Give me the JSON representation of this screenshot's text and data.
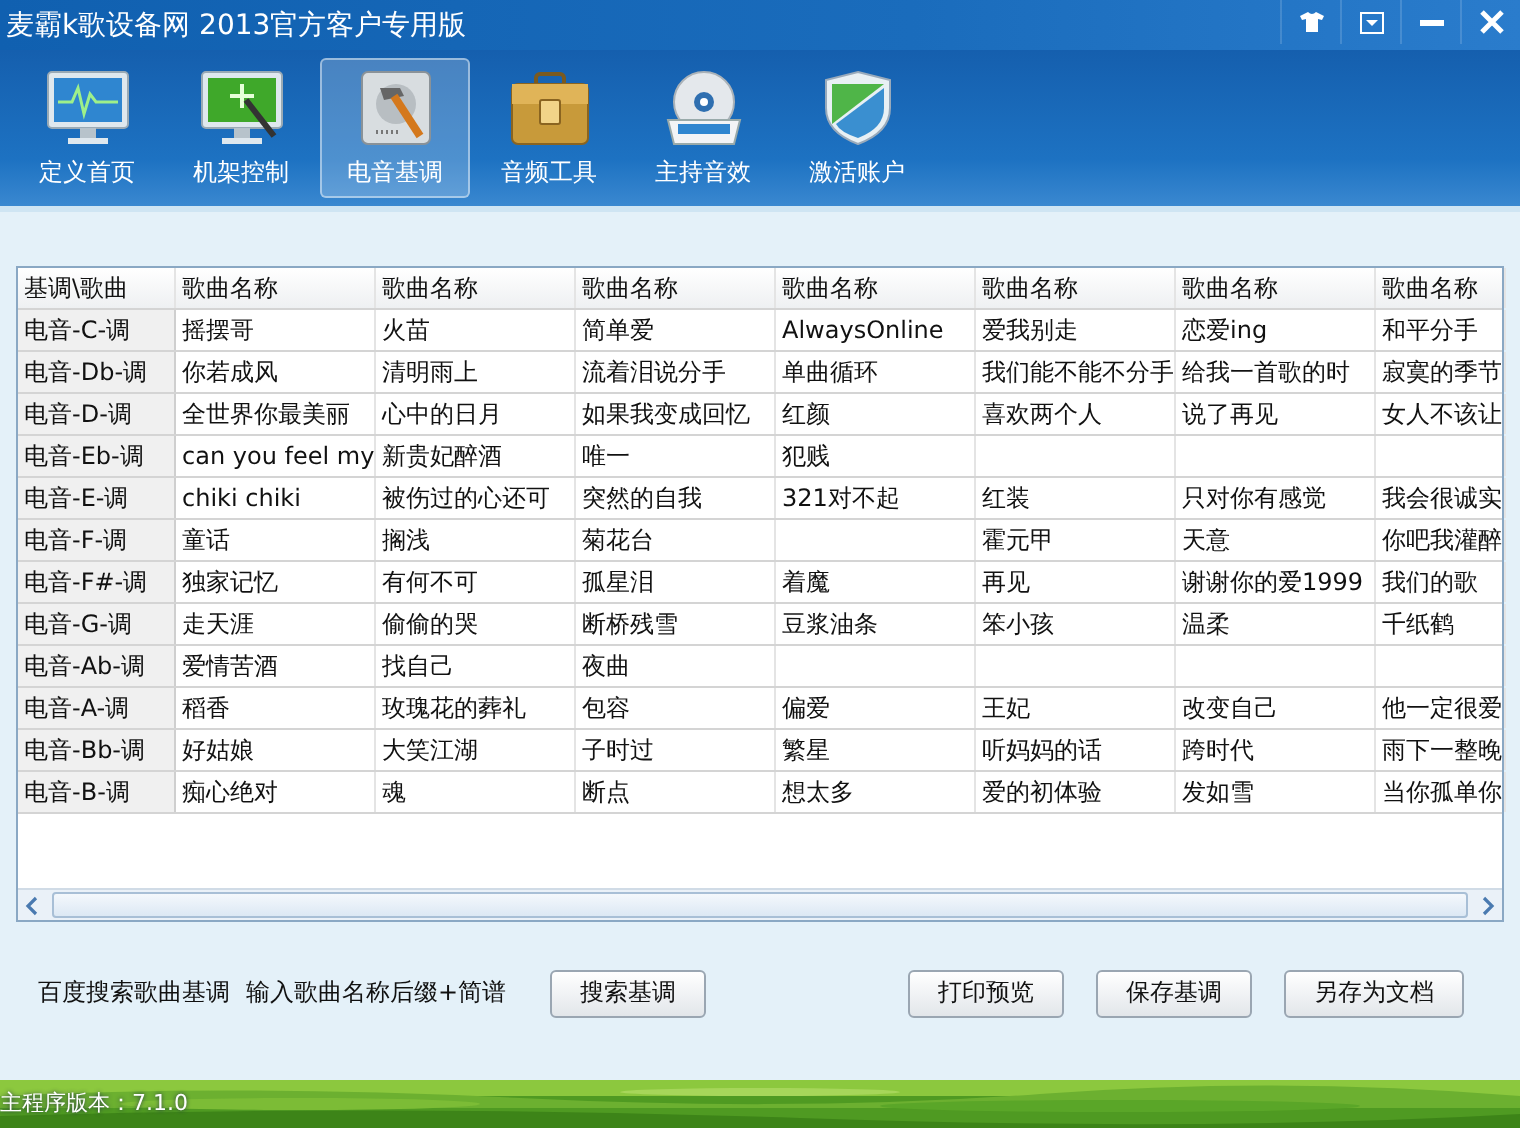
{
  "window": {
    "title": "麦霸k歌设备网 2013官方客户专用版"
  },
  "toolbar": [
    {
      "label": "定义首页",
      "selected": false
    },
    {
      "label": "机架控制",
      "selected": false
    },
    {
      "label": "电音基调",
      "selected": true
    },
    {
      "label": "音频工具",
      "selected": false
    },
    {
      "label": "主持音效",
      "selected": false
    },
    {
      "label": "激活账户",
      "selected": false
    }
  ],
  "table": {
    "columns": [
      "基调\\歌曲",
      "歌曲名称",
      "歌曲名称",
      "歌曲名称",
      "歌曲名称",
      "歌曲名称",
      "歌曲名称",
      "歌曲名称"
    ],
    "rows": [
      [
        "电音-C-调",
        "摇摆哥",
        "火苗",
        "简单爱",
        "AlwaysOnline",
        "爱我别走",
        "恋爱ing",
        "和平分手"
      ],
      [
        "电音-Db-调",
        "你若成风",
        "清明雨上",
        "流着泪说分手",
        "单曲循环",
        "我们能不能不分手",
        "给我一首歌的时",
        "寂寞的季节"
      ],
      [
        "电音-D-调",
        "全世界你最美丽",
        "心中的日月",
        "如果我变成回忆",
        "红颜",
        "喜欢两个人",
        "说了再见",
        "女人不该让"
      ],
      [
        "电音-Eb-调",
        "can you feel my",
        "新贵妃醉酒",
        "唯一",
        "犯贱",
        null,
        null,
        null
      ],
      [
        "电音-E-调",
        "chiki chiki",
        "被伤过的心还可",
        "突然的自我",
        "321对不起",
        "红装",
        "只对你有感觉",
        "我会很诚实"
      ],
      [
        "电音-F-调",
        "童话",
        "搁浅",
        "菊花台",
        null,
        "霍元甲",
        "天意",
        "你吧我灌醉"
      ],
      [
        "电音-F#-调",
        "独家记忆",
        "有何不可",
        "孤星泪",
        "着魔",
        "再见",
        "谢谢你的爱1999",
        "我们的歌"
      ],
      [
        "电音-G-调",
        "走天涯",
        "偷偷的哭",
        "断桥残雪",
        "豆浆油条",
        "笨小孩",
        "温柔",
        "千纸鹤"
      ],
      [
        "电音-Ab-调",
        "爱情苦酒",
        "找自己",
        "夜曲",
        null,
        null,
        null,
        null
      ],
      [
        "电音-A-调",
        "稻香",
        "玫瑰花的葬礼",
        "包容",
        "偏爱",
        "王妃",
        "改变自己",
        "他一定很爱"
      ],
      [
        "电音-Bb-调",
        "好姑娘",
        "大笑江湖",
        "子时过",
        "繁星",
        "听妈妈的话",
        "跨时代",
        "雨下一整晚"
      ],
      [
        "电音-B-调",
        "痴心绝对",
        "魂",
        "断点",
        "想太多",
        "爱的初体验",
        "发如雪",
        "当你孤单你"
      ]
    ]
  },
  "search_hint": {
    "label": "百度搜索歌曲基调",
    "hint": "输入歌曲名称后缀+简谱"
  },
  "buttons": [
    {
      "kind": "search",
      "label": "搜索基调"
    },
    {
      "kind": "action",
      "label": "打印预览"
    },
    {
      "kind": "action",
      "label": "保存基调"
    },
    {
      "kind": "action",
      "label": "另存为文档"
    }
  ],
  "status_bar": {
    "version": "主程序版本：7.1.0"
  }
}
